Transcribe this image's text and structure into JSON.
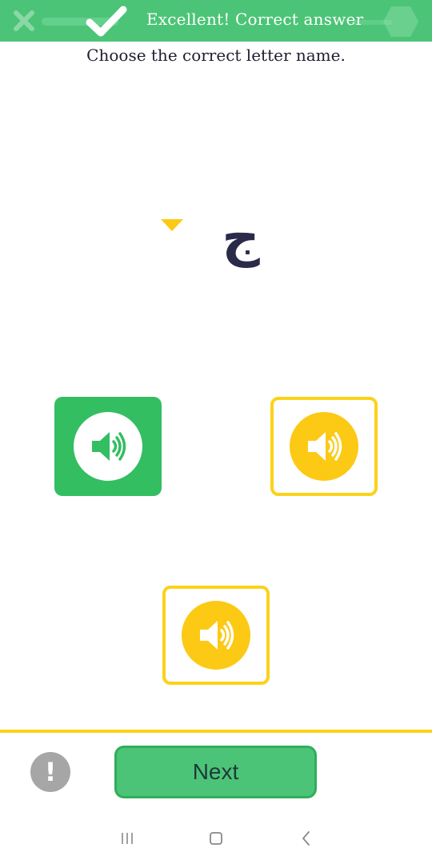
{
  "banner": {
    "message": "Excellent! Correct answer",
    "icon": "check-icon",
    "color": "#4CC477"
  },
  "question": {
    "prompt": "Choose the correct letter name.",
    "letter": "ج"
  },
  "options": [
    {
      "icon": "speaker-icon",
      "state": "correct",
      "color": "#33BE62"
    },
    {
      "icon": "speaker-icon",
      "state": "neutral",
      "color": "#FCD21A"
    },
    {
      "icon": "speaker-icon",
      "state": "neutral",
      "color": "#FCD21A"
    }
  ],
  "footer": {
    "info_symbol": "!",
    "next_label": "Next",
    "accent": "#FCD21A"
  },
  "navbar": {
    "icons": [
      "menu-icon",
      "home-icon",
      "back-icon"
    ]
  }
}
